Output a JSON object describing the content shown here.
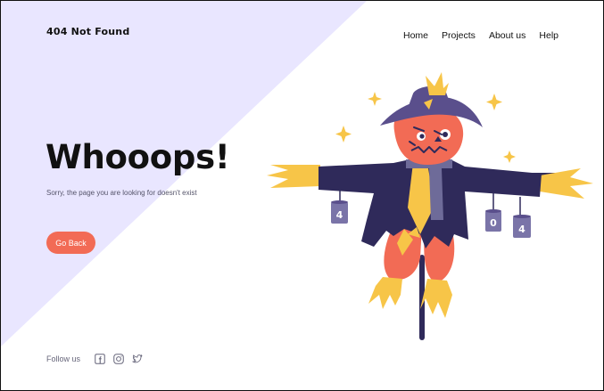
{
  "brand": {
    "logo_text": "404 Not Found"
  },
  "nav": {
    "items": [
      {
        "label": "Home"
      },
      {
        "label": "Projects"
      },
      {
        "label": "About us"
      },
      {
        "label": "Help"
      }
    ]
  },
  "hero": {
    "headline": "Whooops!",
    "subtext": "Sorry, the page you are looking for doesn't exist",
    "button_label": "Go Back"
  },
  "footer": {
    "follow_label": "Follow us",
    "social_icons": [
      "facebook-icon",
      "instagram-icon",
      "twitter-icon"
    ]
  },
  "illustration": {
    "can_left_text": "4",
    "can_mid_text": "0",
    "can_right_text": "4"
  },
  "colors": {
    "accent": "#f26b55",
    "lavender": "#e9e6ff",
    "navy": "#2f2a5a",
    "yellow": "#f7c548",
    "purple_hat": "#5a4f8c"
  }
}
